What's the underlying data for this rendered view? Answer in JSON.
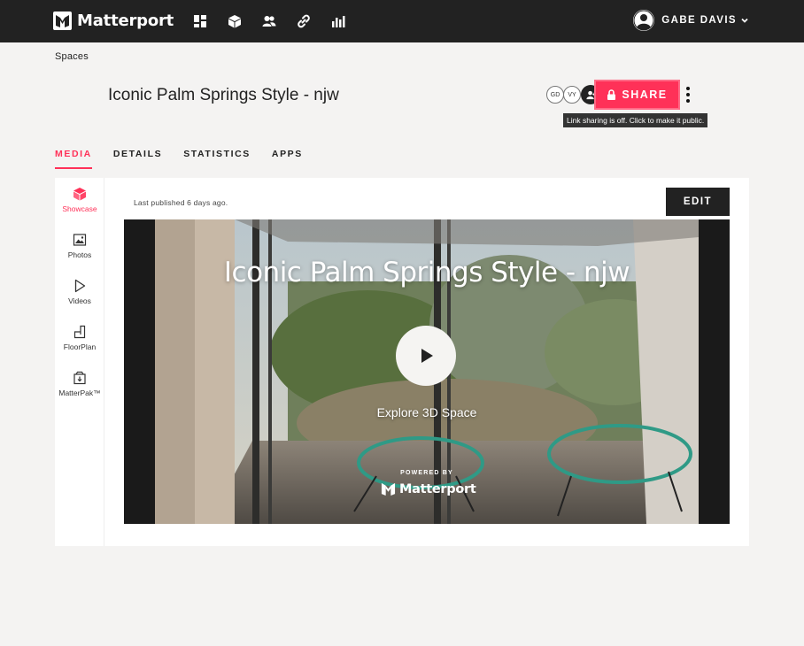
{
  "app": {
    "brand": "Matterport",
    "accent_color": "#ff3158",
    "topbar_color": "#222222"
  },
  "nav": {
    "icons": [
      "dashboard-icon",
      "cube-icon",
      "users-icon",
      "link-icon",
      "chart-icon"
    ]
  },
  "user": {
    "name": "GABE DAVIS"
  },
  "breadcrumb": "Spaces",
  "space": {
    "title": "Iconic Palm Springs Style - njw"
  },
  "collaborators": [
    "GD",
    "VY"
  ],
  "share": {
    "label": "SHARE",
    "tooltip": "Link sharing is off. Click to make it public."
  },
  "tabs": [
    {
      "label": "MEDIA",
      "active": true
    },
    {
      "label": "DETAILS",
      "active": false
    },
    {
      "label": "STATISTICS",
      "active": false
    },
    {
      "label": "APPS",
      "active": false
    }
  ],
  "sidebar": {
    "items": [
      {
        "label": "Showcase",
        "icon": "cube-icon",
        "active": true
      },
      {
        "label": "Photos",
        "icon": "image-icon",
        "active": false
      },
      {
        "label": "Videos",
        "icon": "play-icon",
        "active": false
      },
      {
        "label": "FloorPlan",
        "icon": "floorplan-icon",
        "active": false
      },
      {
        "label": "MatterPak™",
        "icon": "package-icon",
        "active": false
      }
    ]
  },
  "media": {
    "published": "Last published 6 days ago.",
    "edit_label": "EDIT",
    "player_title": "Iconic Palm Springs Style - njw",
    "explore_label": "Explore 3D Space",
    "powered_by": "POWERED BY",
    "powered_brand": "Matterport"
  }
}
